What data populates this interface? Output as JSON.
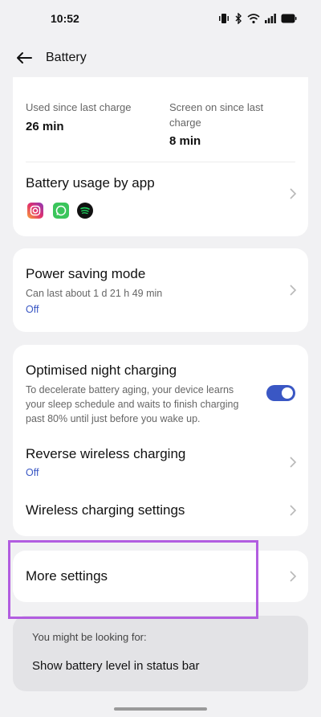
{
  "status_bar": {
    "time": "10:52"
  },
  "header": {
    "title": "Battery"
  },
  "summary": {
    "used_since_label": "Used since last charge",
    "used_since_value": "26 min",
    "screen_on_label_line1": "Screen on since last",
    "screen_on_label_line2": "charge",
    "screen_on_value": "8 min"
  },
  "usage_by_app": {
    "title": "Battery usage by app",
    "apps": [
      "instagram-icon",
      "whatsapp-icon",
      "spotify-icon"
    ]
  },
  "power_saving": {
    "title": "Power saving mode",
    "subtitle": "Can last about 1 d 21 h 49 min",
    "value": "Off"
  },
  "night_charging": {
    "title": "Optimised night charging",
    "desc_line1": "To decelerate battery aging, your device learns",
    "desc_line2": "your sleep schedule and waits to finish charging",
    "desc_line3": "past 80% until just before you wake up.",
    "enabled": true
  },
  "reverse_wireless": {
    "title": "Reverse wireless charging",
    "value": "Off"
  },
  "wireless_settings": {
    "title": "Wireless charging settings"
  },
  "more_settings": {
    "title": "More settings"
  },
  "suggestions": {
    "heading": "You might be looking for:",
    "item": "Show battery level in status bar"
  },
  "colors": {
    "accent": "#3a57c4",
    "highlight": "#b25de0"
  }
}
